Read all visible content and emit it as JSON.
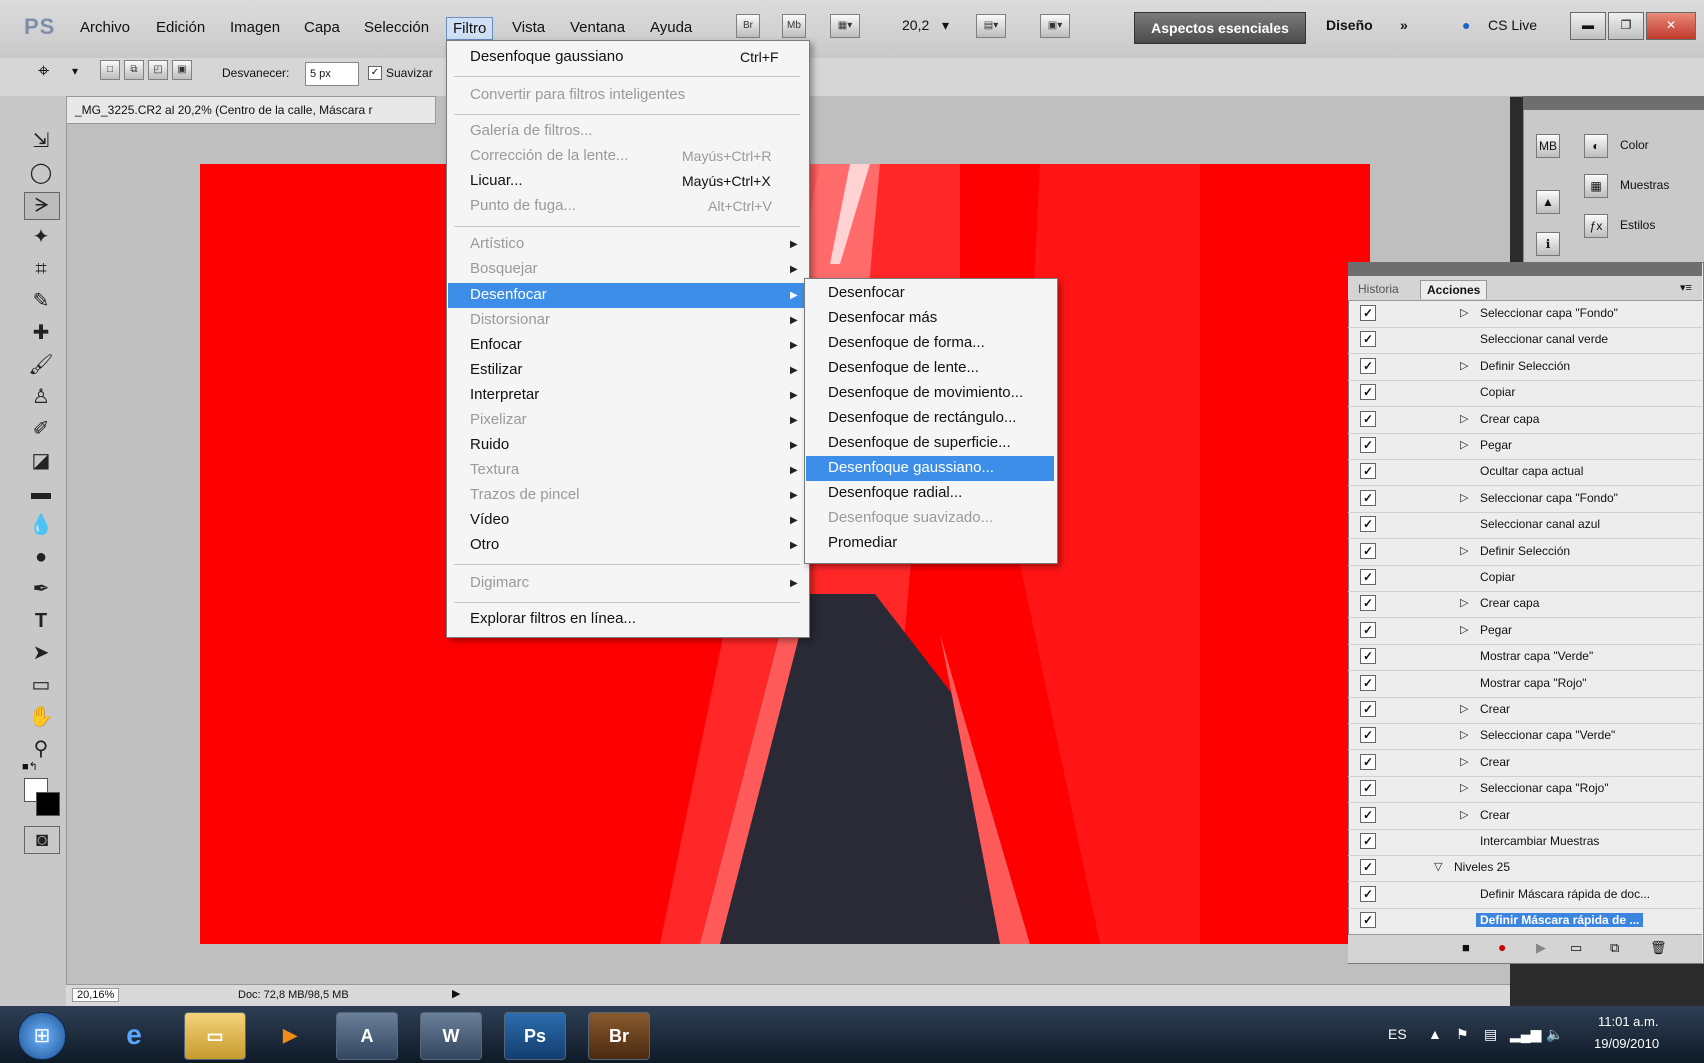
{
  "menubar": {
    "logo": "PS",
    "items": [
      "Archivo",
      "Edición",
      "Imagen",
      "Capa",
      "Selección",
      "Filtro",
      "Vista",
      "Ventana",
      "Ayuda"
    ],
    "active": "Filtro",
    "icons": [
      "Br",
      "Mb"
    ],
    "zoom": "20,2",
    "workspace": "Aspectos esenciales",
    "design": "Diseño",
    "more": "»",
    "cslive": "CS Live"
  },
  "options": {
    "feather_label": "Desvanecer:",
    "feather_value": "5 px",
    "antialias_label": "Suavizar"
  },
  "document": {
    "tab_title": "_MG_3225.CR2 al 20,2% (Centro de la calle, Máscara r",
    "status_zoom": "20,16%",
    "status_doc": "Doc: 72,8 MB/98,5 MB"
  },
  "filter_menu": {
    "items": [
      {
        "label": "Desenfoque gaussiano",
        "shortcut": "Ctrl+F",
        "disabled": false
      },
      {
        "label": "Convertir para filtros inteligentes",
        "shortcut": "",
        "disabled": true
      },
      {
        "label": "Galería de filtros...",
        "shortcut": "",
        "disabled": true
      },
      {
        "label": "Corrección de la lente...",
        "shortcut": "Mayús+Ctrl+R",
        "disabled": true
      },
      {
        "label": "Licuar...",
        "shortcut": "Mayús+Ctrl+X",
        "disabled": false
      },
      {
        "label": "Punto de fuga...",
        "shortcut": "Alt+Ctrl+V",
        "disabled": true
      },
      {
        "label": "Artístico",
        "disabled": true
      },
      {
        "label": "Bosquejar",
        "disabled": true
      },
      {
        "label": "Desenfocar",
        "disabled": false
      },
      {
        "label": "Distorsionar",
        "disabled": true
      },
      {
        "label": "Enfocar",
        "disabled": false
      },
      {
        "label": "Estilizar",
        "disabled": false
      },
      {
        "label": "Interpretar",
        "disabled": false
      },
      {
        "label": "Pixelizar",
        "disabled": true
      },
      {
        "label": "Ruido",
        "disabled": false
      },
      {
        "label": "Textura",
        "disabled": true
      },
      {
        "label": "Trazos de pincel",
        "disabled": true
      },
      {
        "label": "Vídeo",
        "disabled": false
      },
      {
        "label": "Otro",
        "disabled": false
      },
      {
        "label": "Digimarc",
        "disabled": true
      },
      {
        "label": "Explorar filtros en línea...",
        "disabled": false
      }
    ]
  },
  "blur_submenu": {
    "items": [
      {
        "label": "Desenfocar",
        "disabled": false
      },
      {
        "label": "Desenfocar más",
        "disabled": false
      },
      {
        "label": "Desenfoque de forma...",
        "disabled": false
      },
      {
        "label": "Desenfoque de lente...",
        "disabled": false
      },
      {
        "label": "Desenfoque de movimiento...",
        "disabled": false
      },
      {
        "label": "Desenfoque de rectángulo...",
        "disabled": false
      },
      {
        "label": "Desenfoque de superficie...",
        "disabled": false
      },
      {
        "label": "Desenfoque gaussiano...",
        "disabled": false,
        "selected": true
      },
      {
        "label": "Desenfoque radial...",
        "disabled": false
      },
      {
        "label": "Desenfoque suavizado...",
        "disabled": true
      },
      {
        "label": "Promediar",
        "disabled": false
      }
    ]
  },
  "dock": {
    "items": [
      "Color",
      "Muestras",
      "Estilos"
    ],
    "icons": [
      "MB"
    ]
  },
  "actions_panel": {
    "tabs": [
      "Historia",
      "Acciones"
    ],
    "active_tab": "Acciones",
    "rows": [
      {
        "label": "Seleccionar capa \"Fondo\"",
        "expandable": true
      },
      {
        "label": "Seleccionar canal verde",
        "expandable": false
      },
      {
        "label": "Definir Selección",
        "expandable": true
      },
      {
        "label": "Copiar",
        "expandable": false
      },
      {
        "label": "Crear capa",
        "expandable": true
      },
      {
        "label": "Pegar",
        "expandable": true
      },
      {
        "label": "Ocultar capa actual",
        "expandable": false
      },
      {
        "label": "Seleccionar capa \"Fondo\"",
        "expandable": true
      },
      {
        "label": "Seleccionar canal azul",
        "expandable": false
      },
      {
        "label": "Definir Selección",
        "expandable": true
      },
      {
        "label": "Copiar",
        "expandable": false
      },
      {
        "label": "Crear capa",
        "expandable": true
      },
      {
        "label": "Pegar",
        "expandable": true
      },
      {
        "label": "Mostrar capa \"Verde\"",
        "expandable": false
      },
      {
        "label": "Mostrar capa \"Rojo\"",
        "expandable": false
      },
      {
        "label": "Crear",
        "expandable": true
      },
      {
        "label": "Seleccionar capa \"Verde\"",
        "expandable": true
      },
      {
        "label": "Crear",
        "expandable": true
      },
      {
        "label": "Seleccionar capa \"Rojo\"",
        "expandable": true
      },
      {
        "label": "Crear",
        "expandable": true
      },
      {
        "label": "Intercambiar Muestras",
        "expandable": false
      },
      {
        "label": "Niveles 25",
        "expandable": true,
        "group": true
      },
      {
        "label": "Definir Máscara rápida de doc...",
        "expandable": false
      },
      {
        "label": "Definir Máscara rápida de ...",
        "expandable": false,
        "selected": true
      }
    ]
  },
  "taskbar": {
    "apps": [
      "IE",
      "Explorer",
      "Media",
      "Acrobat",
      "Word",
      "Ps",
      "Br"
    ],
    "lang": "ES",
    "time": "11:01 a.m.",
    "date": "19/09/2010"
  },
  "colors": {
    "canvas": "#ff0000",
    "highlight": "#3d8ee8"
  }
}
